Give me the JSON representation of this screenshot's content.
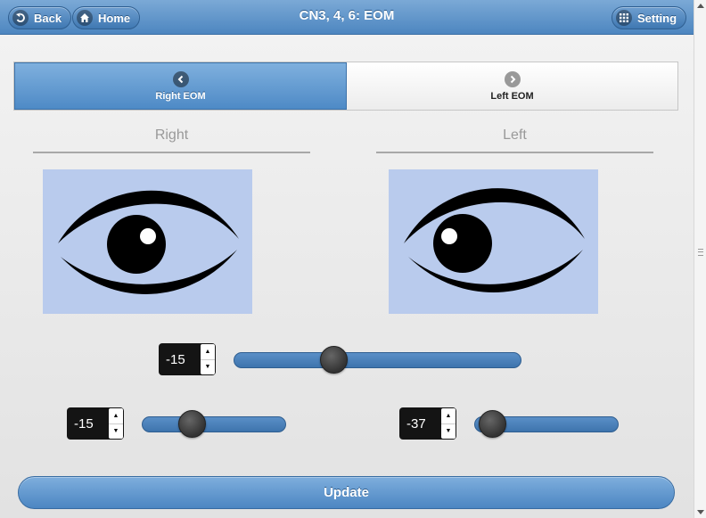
{
  "header": {
    "title": "CN3, 4, 6: EOM",
    "back_label": "Back",
    "home_label": "Home",
    "setting_label": "Setting"
  },
  "tabs": [
    {
      "label": "Right EOM",
      "icon": "chevron-left-icon",
      "active": true
    },
    {
      "label": "Left EOM",
      "icon": "chevron-right-icon",
      "active": false
    }
  ],
  "eyes": {
    "right_label": "Right",
    "left_label": "Left",
    "background_color": "#b9cbed"
  },
  "controls": {
    "vertical": {
      "value": "-15",
      "min": -45,
      "max": 45
    },
    "right_horizontal": {
      "value": "-15",
      "min": -45,
      "max": 45
    },
    "left_horizontal": {
      "value": "-37",
      "min": -45,
      "max": 45
    }
  },
  "update_label": "Update",
  "colors": {
    "accent": "#4e8ac6",
    "header": "#5b8fc6"
  }
}
